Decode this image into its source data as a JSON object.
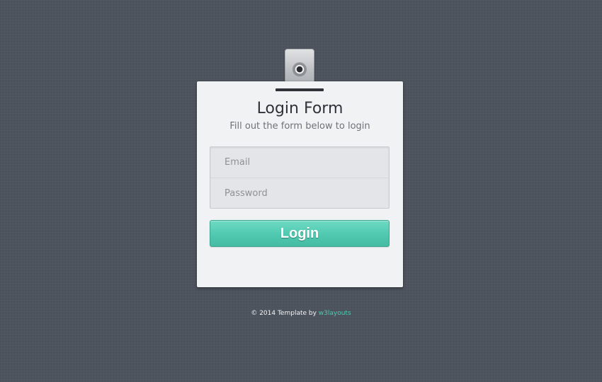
{
  "login": {
    "title": "Login Form",
    "subtitle": "Fill out the form below to login",
    "email_placeholder": "Email",
    "email_value": "",
    "password_placeholder": "Password",
    "password_value": "",
    "button_label": "Login"
  },
  "footer": {
    "copyright": "© 2014 Template by ",
    "link_text": "w3layouts"
  },
  "colors": {
    "background": "#4e545e",
    "card": "#f1f2f4",
    "accent": "#4fc9b0"
  },
  "icons": {
    "clip": "badge-clip-icon"
  }
}
